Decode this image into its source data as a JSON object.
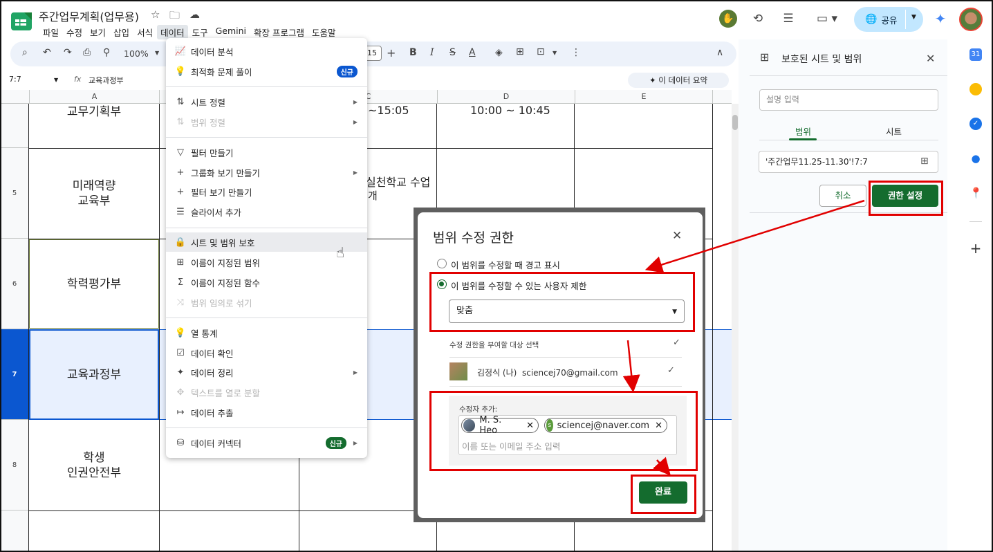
{
  "header": {
    "doc_title": "주간업무계획(업무용)",
    "menu": [
      "파일",
      "수정",
      "보기",
      "삽입",
      "서식",
      "데이터",
      "도구",
      "Gemini",
      "확장 프로그램",
      "도움말"
    ],
    "share_label": "공유"
  },
  "toolbar": {
    "zoom": "100%",
    "font_size": "15"
  },
  "formula_bar": {
    "name_box": "7:7",
    "fx": "fx",
    "formula": "교육과정부",
    "summary_button": "이 데이터 요약"
  },
  "grid": {
    "columns": [
      "A",
      "C",
      "D",
      "E"
    ],
    "rows": [
      {
        "num": "",
        "a": "교무기획부"
      },
      {
        "num": "5",
        "a": "미래역량\n교육부"
      },
      {
        "num": "6",
        "a": "학력평가부"
      },
      {
        "num": "7",
        "a": "교육과정부"
      },
      {
        "num": "8",
        "a": "학생\n인권안전부"
      },
      {
        "num": "",
        "a": ""
      }
    ],
    "c_row4": "~15:05",
    "d_row4": "10:00 ~ 10:45",
    "c_row5": "실천학교 수업",
    "c_row5b": "개"
  },
  "data_menu": {
    "items": [
      {
        "label": "데이터 분석",
        "icon": "📈"
      },
      {
        "label": "최적화 문제 풀이",
        "icon": "💡",
        "badge": "신규"
      },
      {
        "label": "시트 정렬",
        "icon": "⇅"
      },
      {
        "label": "범위 정렬",
        "icon": "⇅"
      },
      {
        "label": "필터 만들기",
        "icon": "▽"
      },
      {
        "label": "그룹화 보기 만들기",
        "icon": "+"
      },
      {
        "label": "필터 보기 만들기",
        "icon": "+"
      },
      {
        "label": "슬라이서 추가",
        "icon": "☰"
      },
      {
        "label": "시트 및 범위 보호",
        "icon": "🔒"
      },
      {
        "label": "이름이 지정된 범위",
        "icon": "⊞"
      },
      {
        "label": "이름이 지정된 함수",
        "icon": "Σ"
      },
      {
        "label": "범위 임의로 섞기",
        "icon": "⤨"
      },
      {
        "label": "열 통계",
        "icon": "💡"
      },
      {
        "label": "데이터 확인",
        "icon": "☑"
      },
      {
        "label": "데이터 정리",
        "icon": "✦"
      },
      {
        "label": "텍스트를 열로 분할",
        "icon": "✥"
      },
      {
        "label": "데이터 추출",
        "icon": "↦"
      },
      {
        "label": "데이터 커넥터",
        "icon": "⛁",
        "badge": "신규"
      }
    ]
  },
  "dialog": {
    "title": "범위 수정 권한",
    "option_warn": "이 범위를 수정할 때 경고 표시",
    "option_restrict": "이 범위를 수정할 수 있는 사용자 제한",
    "select_value": "맞춤",
    "grant_label": "수정 권한을 부여할 대상 선택",
    "user_name": "김정식 (나)",
    "user_email": "sciencej70@gmail.com",
    "editor_label": "수정자 추가:",
    "chips": [
      {
        "label": "M. S. Heo"
      },
      {
        "label": "sciencej@naver.com",
        "avatar_letter": "s"
      }
    ],
    "editor_placeholder": "이름 또는 이메일 주소 입력",
    "done_label": "완료"
  },
  "side_panel": {
    "title": "보호된 시트 및 범위",
    "desc_placeholder": "설명 입력",
    "tab_range": "범위",
    "tab_sheet": "시트",
    "range_value": "'주간업무11.25-11.30'!7:7",
    "cancel_label": "취소",
    "permission_label": "권한 설정"
  },
  "rail": {
    "calendar_label": "31"
  },
  "colors": {
    "accent_green": "#146c2e",
    "selection_blue": "#0b57d0",
    "annotation_red": "#e10000"
  }
}
